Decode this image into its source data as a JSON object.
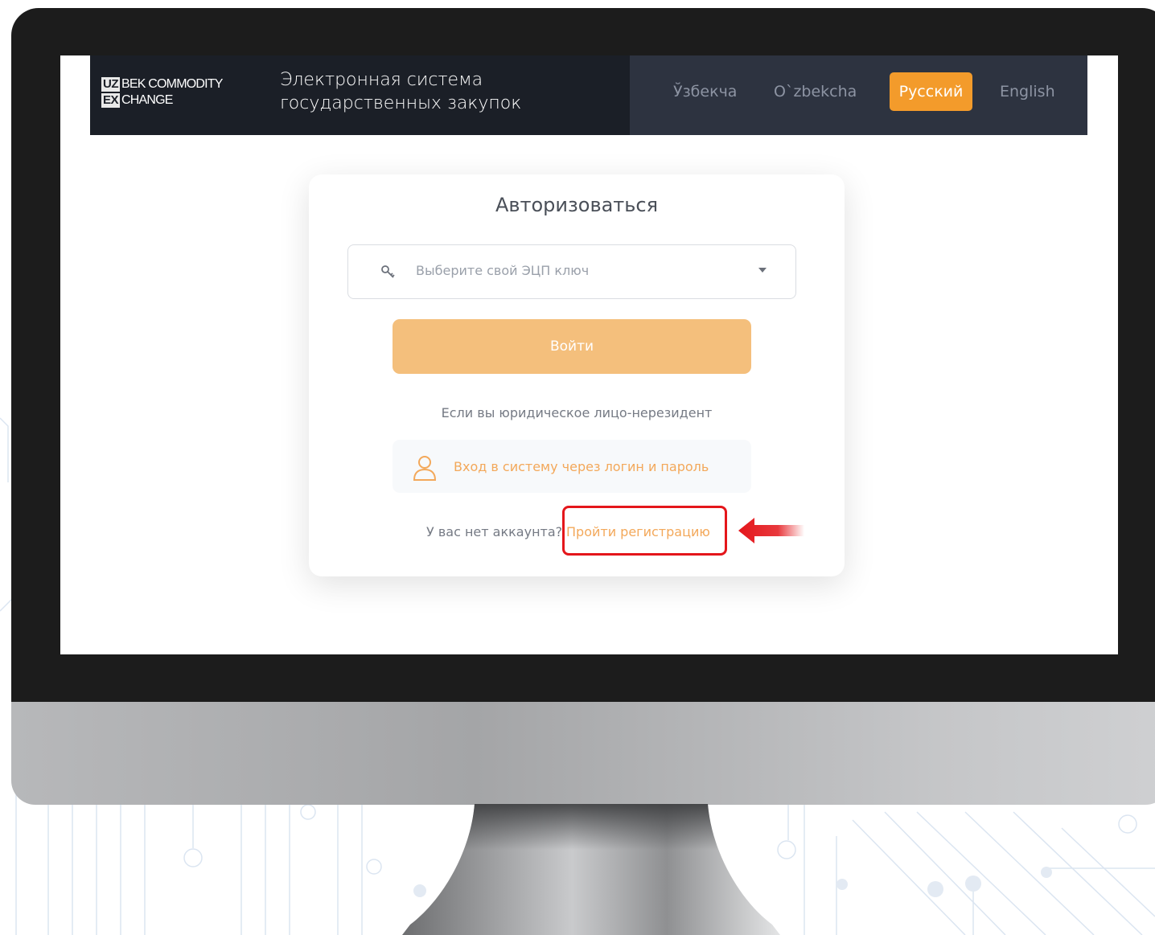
{
  "header": {
    "logo": {
      "box1": "UZ",
      "text1": "BEK COMMODITY",
      "box2": "EX",
      "text2": "CHANGE"
    },
    "system_title_line1": "Электронная система",
    "system_title_line2": "государственных закупок",
    "languages": [
      {
        "label": "Ўзбекча",
        "active": false
      },
      {
        "label": "O`zbekcha",
        "active": false
      },
      {
        "label": "Русский",
        "active": true
      },
      {
        "label": "English",
        "active": false
      }
    ]
  },
  "auth": {
    "title": "Авторизоваться",
    "key_select_placeholder": "Выберите свой ЭЦП ключ",
    "login_button": "Войти",
    "nonresident_text": "Если вы юридическое лицо-нерезидент",
    "login_password_link": "Вход в систему через логин и пароль",
    "no_account_text": "У вас нет аккаунта?",
    "register_link": "Пройти регистрацию"
  },
  "colors": {
    "accent": "#f39b2b",
    "button_disabled": "#f4bf7c",
    "header_bg": "#2d3340",
    "highlight": "#e4161b"
  },
  "icons": [
    "key-icon",
    "chevron-down-icon",
    "user-icon",
    "red-arrow-icon"
  ]
}
